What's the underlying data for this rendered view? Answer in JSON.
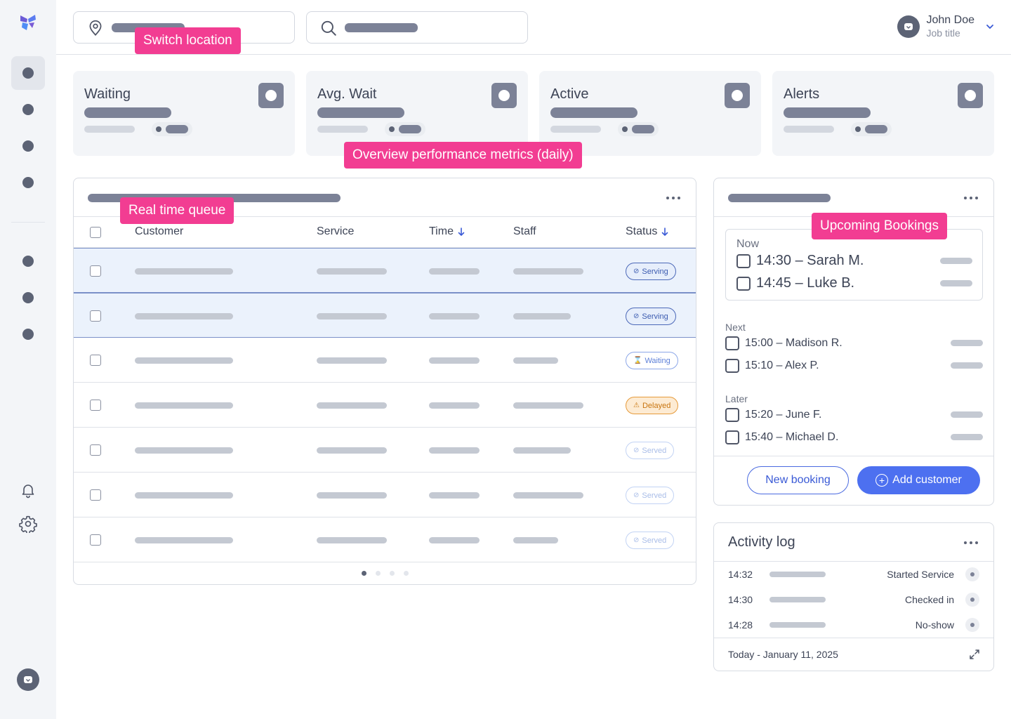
{
  "user": {
    "name": "John Doe",
    "title": "Job title"
  },
  "annotations": {
    "switch_location": "Switch location",
    "overview_metrics": "Overview performance metrics (daily)",
    "realtime_queue": "Real time queue",
    "upcoming_bookings": "Upcoming Bookings"
  },
  "metrics": [
    {
      "title": "Waiting"
    },
    {
      "title": "Avg. Wait"
    },
    {
      "title": "Active"
    },
    {
      "title": "Alerts"
    }
  ],
  "queue": {
    "columns": {
      "customer": "Customer",
      "service": "Service",
      "time": "Time",
      "staff": "Staff",
      "status": "Status"
    },
    "rows": [
      {
        "status": "Serving",
        "status_icon": "check-circle-icon",
        "selected": true
      },
      {
        "status": "Serving",
        "status_icon": "check-circle-icon",
        "selected": true
      },
      {
        "status": "Waiting",
        "status_icon": "hourglass-icon",
        "selected": false
      },
      {
        "status": "Delayed",
        "status_icon": "warning-icon",
        "selected": false
      },
      {
        "status": "Served",
        "status_icon": "check-circle-icon",
        "selected": false
      },
      {
        "status": "Served",
        "status_icon": "check-circle-icon",
        "selected": false
      },
      {
        "status": "Served",
        "status_icon": "check-circle-icon",
        "selected": false
      }
    ],
    "pages": 4,
    "current_page": 1
  },
  "bookings": {
    "now_label": "Now",
    "now": [
      "14:30 – Sarah M.",
      "14:45 – Luke B."
    ],
    "next_label": "Next",
    "next": [
      "15:00 – Madison R.",
      "15:10 – Alex P."
    ],
    "later_label": "Later",
    "later": [
      "15:20 – June F.",
      "15:40 – Michael D."
    ],
    "new_booking_label": "New booking",
    "add_customer_label": "Add customer"
  },
  "activity": {
    "title": "Activity log",
    "entries": [
      {
        "time": "14:32",
        "event": "Started Service"
      },
      {
        "time": "14:30",
        "event": "Checked in"
      },
      {
        "time": "14:28",
        "event": "No-show"
      }
    ],
    "date": "Today - January 11, 2025"
  },
  "colors": {
    "accent": "#4d70f0",
    "annotation": "#f23d92",
    "serving": "#4b68b8",
    "delayed": "#e69a3a"
  }
}
